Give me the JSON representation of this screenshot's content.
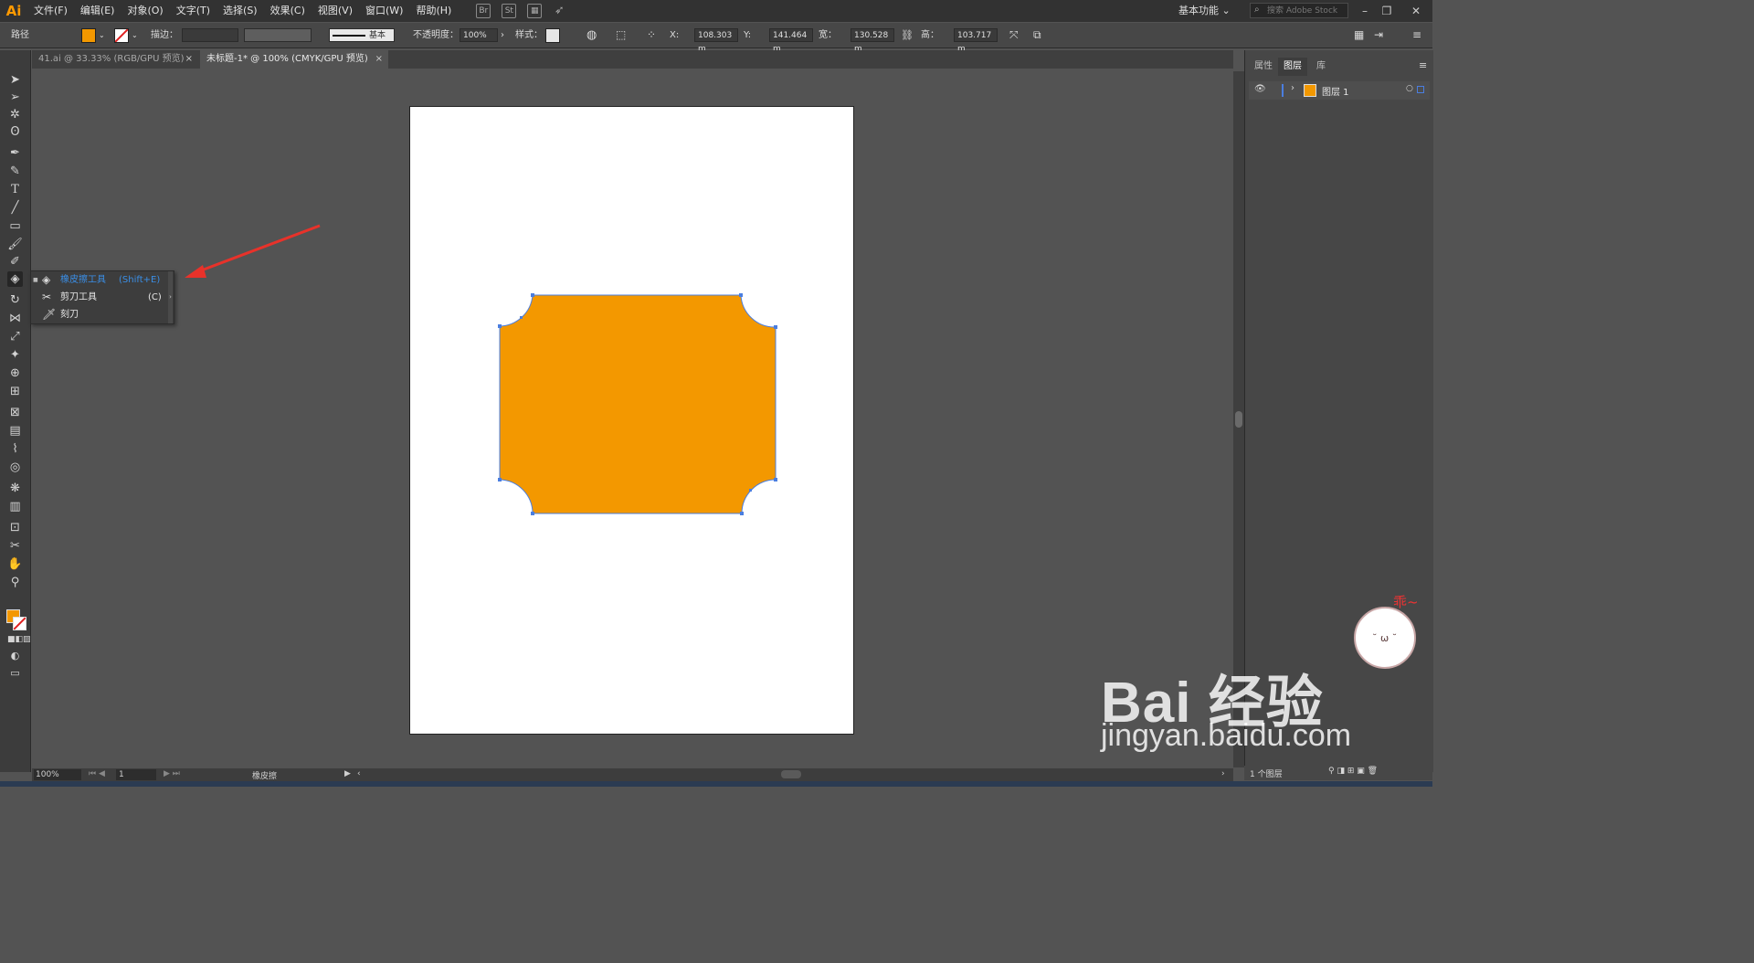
{
  "app": {
    "logo": "Ai"
  },
  "menu": [
    "文件(F)",
    "编辑(E)",
    "对象(O)",
    "文字(T)",
    "选择(S)",
    "效果(C)",
    "视图(V)",
    "窗口(W)",
    "帮助(H)"
  ],
  "menubar_icons": {
    "bridge": "Br",
    "stock": "St"
  },
  "workspace": "基本功能",
  "search_placeholder": "搜索 Adobe Stock",
  "control": {
    "selection_label": "路径",
    "fill_color": "#f39800",
    "stroke_label": "描边：",
    "stroke_style": "基本",
    "opacity_label": "不透明度：",
    "opacity_value": "100%",
    "style_label": "样式：",
    "x_label": "X:",
    "x_value": "108.303 m",
    "y_label": "Y:",
    "y_value": "141.464 m",
    "w_label": "宽：",
    "w_value": "130.528 m",
    "h_label": "高：",
    "h_value": "103.717 m"
  },
  "tabs": [
    {
      "label": "41.ai @ 33.33% (RGB/GPU 预览)",
      "close": "×",
      "active": false
    },
    {
      "label": "未标题-1* @ 100% (CMYK/GPU 预览)",
      "close": "×",
      "active": true
    }
  ],
  "flyout": [
    {
      "label": "橡皮擦工具",
      "shortcut": "(Shift+E)",
      "icon": "eraser-icon",
      "selected": true
    },
    {
      "label": "剪刀工具",
      "shortcut": "(C)",
      "icon": "scissors-icon",
      "selected": false
    },
    {
      "label": "刻刀",
      "shortcut": "",
      "icon": "knife-icon",
      "selected": false
    }
  ],
  "shape": {
    "fill": "#f39800",
    "stroke": "#4a7ee0"
  },
  "right_panel": {
    "tabs": [
      "属性",
      "图层",
      "库"
    ],
    "active_tab": "图层",
    "layer_name": "图层 1",
    "layer_color": "#f39800",
    "footer": "1 个图层"
  },
  "status": {
    "zoom": "100%",
    "page": "1",
    "tool": "橡皮擦"
  },
  "watermark": {
    "logo_text": "Bai 经验",
    "url": "jingyan.baidu.com",
    "mascot_text": "乖~"
  }
}
